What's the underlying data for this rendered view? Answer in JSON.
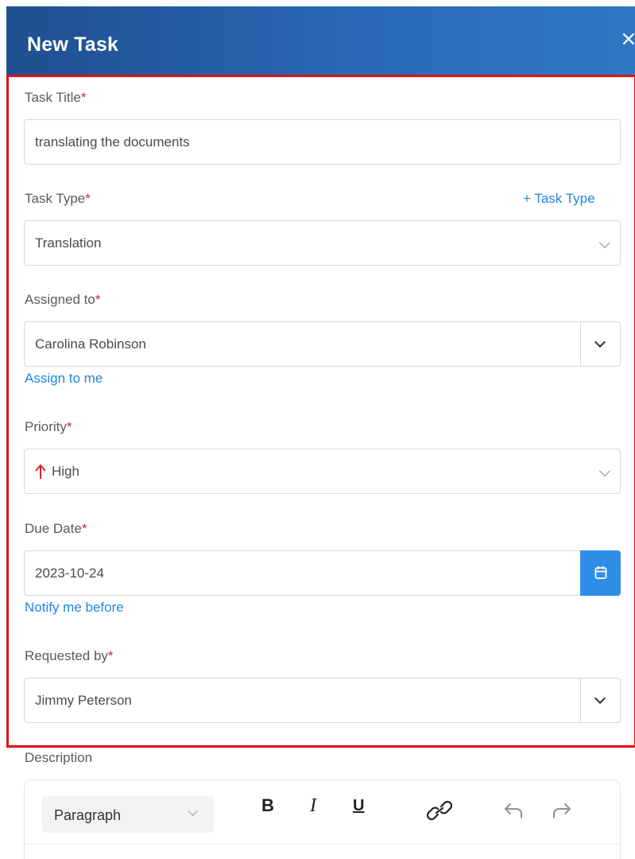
{
  "header": {
    "title": "New Task",
    "close_glyph": "×"
  },
  "required_mark": "*",
  "task_title": {
    "label": "Task Title",
    "value": "translating the documents"
  },
  "task_type": {
    "label": "Task Type",
    "add_link": "+ Task Type",
    "value": "Translation"
  },
  "assigned_to": {
    "label": "Assigned to",
    "value": "Carolina Robinson",
    "link": "Assign to me"
  },
  "priority": {
    "label": "Priority",
    "value": "High",
    "arrow_color": "#d9232a"
  },
  "due_date": {
    "label": "Due Date",
    "value": "2023-10-24",
    "link": "Notify me before"
  },
  "requested_by": {
    "label": "Requested by",
    "value": "Jimmy Peterson"
  },
  "description": {
    "label": "Description",
    "toolbar": {
      "block_format": "Paragraph",
      "bold": "B",
      "italic": "I",
      "underline": "U"
    }
  },
  "colors": {
    "accent": "#1f86e0",
    "header": "#2a6bb8",
    "highlight_border": "#e3101a",
    "calendar_button": "#2f8fe8"
  },
  "icons": [
    "close-icon",
    "chevron-down-icon",
    "arrow-up-icon",
    "calendar-icon",
    "link-icon",
    "undo-icon",
    "redo-icon"
  ]
}
